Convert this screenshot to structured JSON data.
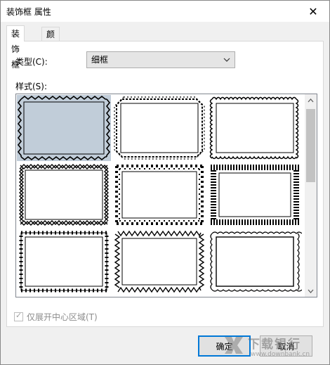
{
  "window": {
    "title": "装饰框 属性",
    "close_glyph": "✕"
  },
  "tabs": [
    {
      "label": "装饰框",
      "active": true
    },
    {
      "label": "颜色",
      "active": false
    }
  ],
  "type_field": {
    "label": "类型(C):",
    "value": "细框"
  },
  "style_field": {
    "label": "样式(S):",
    "selected_index": 0,
    "items": [
      "zigzag",
      "cut-corner-zigzag",
      "wavy",
      "double-zigzag",
      "diamond-dots",
      "vertical-hatch",
      "x-marks",
      "double-zigzag-inner",
      "wavy-thin"
    ]
  },
  "checkbox": {
    "label": "仅展开中心区域(T)",
    "checked": true,
    "disabled": true
  },
  "buttons": {
    "ok": "确定",
    "cancel": "取消"
  },
  "watermark": {
    "cn": "下载银行",
    "en": "www.downbank.cn"
  },
  "colors": {
    "selection": "#c1cdd9",
    "accent": "#0078d7"
  }
}
